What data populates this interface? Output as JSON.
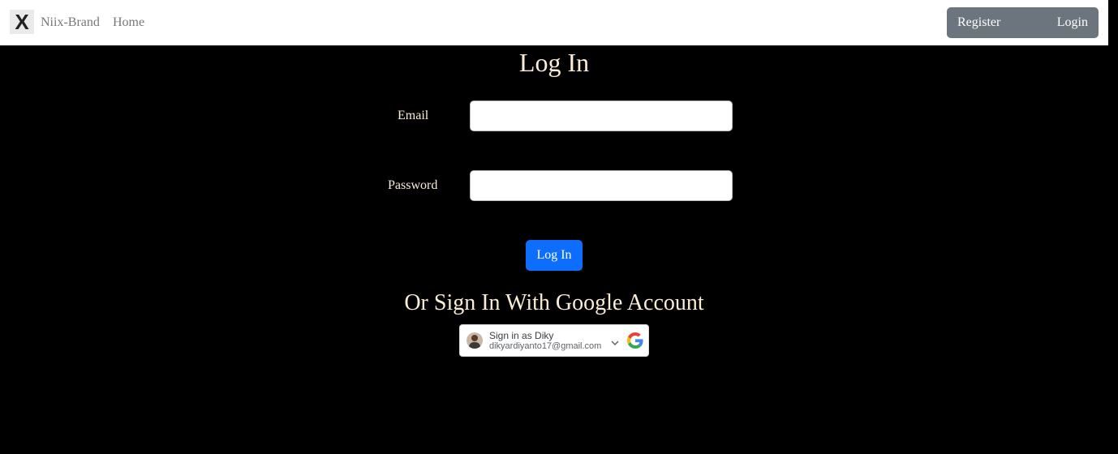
{
  "navbar": {
    "logo_glyph": "X",
    "brand_name": "Niix-Brand",
    "home_link": "Home",
    "register_label": "Register",
    "login_label": "Login",
    "auth_group_color": "#6c757d"
  },
  "form": {
    "title": "Log In",
    "email_label": "Email",
    "email_value": "",
    "password_label": "Password",
    "password_value": "",
    "submit_label": "Log In",
    "submit_color": "#0d6efd"
  },
  "google": {
    "heading": "Or Sign In With Google Account",
    "name_line": "Sign in as Diky",
    "email_line": "dikyardiyanto17@gmail.com",
    "chevron_icon": "chevron-down-icon",
    "logo_icon": "google-logo-icon"
  },
  "colors": {
    "page_background": "#000000",
    "text_cream": "#fbecd6"
  }
}
